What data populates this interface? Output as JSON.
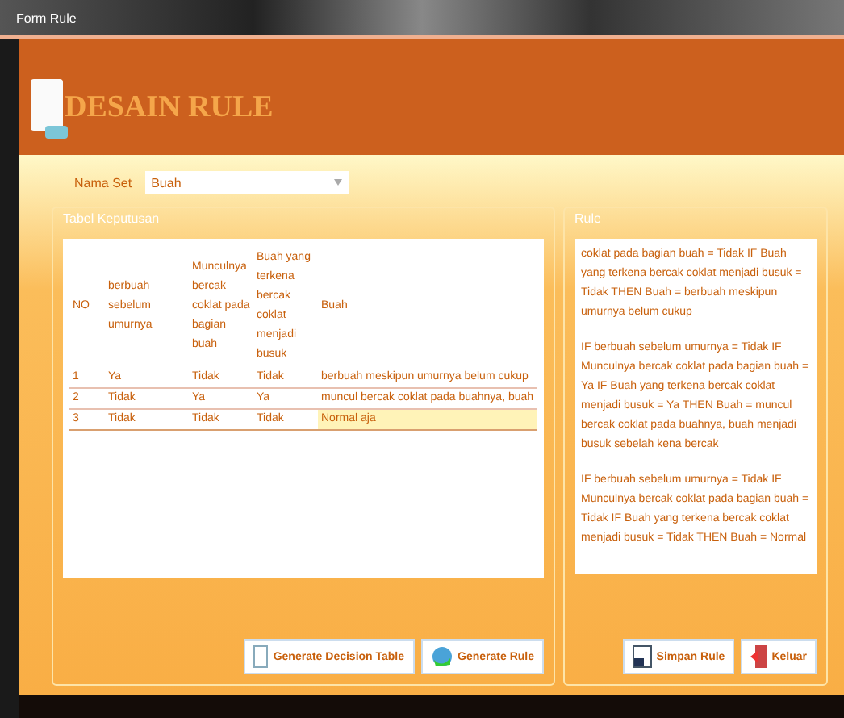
{
  "window": {
    "title": "Form Rule"
  },
  "header": {
    "title": "DESAIN RULE"
  },
  "nama_set": {
    "label": "Nama Set",
    "value": "Buah"
  },
  "decision_table": {
    "title": "Tabel Keputusan",
    "columns": [
      "NO",
      "berbuah sebelum umurnya",
      "Munculnya bercak coklat pada bagian buah",
      "Buah yang terkena bercak coklat menjadi busuk",
      "Buah"
    ],
    "rows": [
      {
        "cells": [
          "1",
          "Ya",
          "Tidak",
          "Tidak",
          "berbuah meskipun umurnya belum cukup"
        ],
        "selected": false
      },
      {
        "cells": [
          "2",
          "Tidak",
          "Ya",
          "Ya",
          "muncul bercak coklat pada buahnya, buah"
        ],
        "selected": false
      },
      {
        "cells": [
          "3",
          "Tidak",
          "Tidak",
          "Tidak",
          "Normal aja"
        ],
        "selected": true
      }
    ],
    "buttons": [
      "Generate Decision Table",
      "Generate Rule"
    ]
  },
  "rule": {
    "title": "Rule",
    "paragraphs": [
      "coklat pada bagian buah = Tidak IF Buah yang terkena bercak coklat menjadi busuk = Tidak THEN Buah = berbuah meskipun umurnya belum cukup",
      "IF berbuah sebelum umurnya = Tidak IF Munculnya bercak coklat pada bagian buah = Ya IF Buah yang terkena bercak coklat menjadi busuk = Ya THEN Buah = muncul bercak coklat pada buahnya, buah menjadi busuk sebelah kena bercak",
      "IF berbuah sebelum umurnya = Tidak IF Munculnya bercak coklat pada bagian buah = Tidak IF Buah yang terkena bercak coklat menjadi busuk = Tidak THEN Buah = Normal"
    ],
    "buttons": [
      "Simpan Rule",
      "Keluar"
    ]
  }
}
